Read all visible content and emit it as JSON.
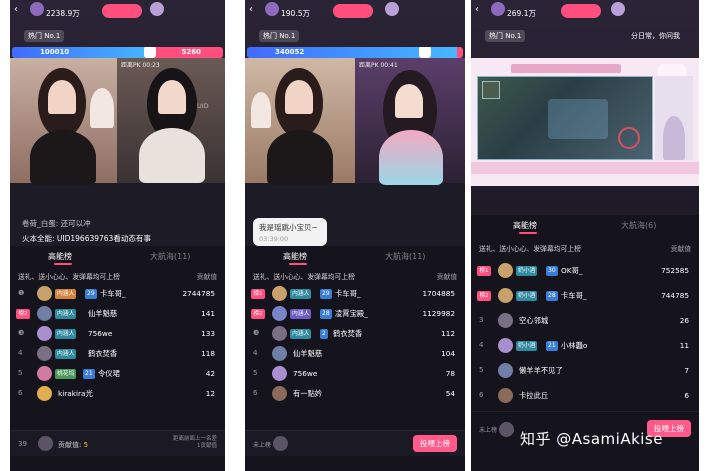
{
  "panels": [
    {
      "fans": "2238.9万",
      "hot": "热门 No.1",
      "pk_left": "100010",
      "pk_right": "5260",
      "timer_left": "距离PK 00:23",
      "uid_text": "UID",
      "chat": [
        {
          "text": "卷荷_白蛋: 还可以冲",
          "dim": true
        },
        {
          "text": "火本全能: UID196639763看动态有事",
          "dim": false
        }
      ],
      "tabs": {
        "active": "高能榜",
        "inactive": "大航海(11)"
      },
      "hint": "送礼、送小心心、发弹幕均可上榜",
      "hint_right": "贡献值",
      "rows": [
        {
          "rank": "",
          "tag": "内涵人",
          "lvl": "29",
          "name": "卡车哥_",
          "score": "2744785",
          "color": "#c9a26b"
        },
        {
          "rank": "榜2",
          "tag": "内涵人",
          "lvl": "",
          "name": "仙羊魁慈",
          "score": "141",
          "color": "#6f7fa6"
        },
        {
          "rank": "",
          "tag": "内涵人",
          "lvl": "",
          "name": "756we",
          "score": "133",
          "color": "#a98fd0"
        },
        {
          "rank": "4",
          "tag": "内涵人",
          "lvl": "",
          "name": "鹤衣焚香",
          "score": "118",
          "color": "#7a6f85"
        },
        {
          "rank": "5",
          "tag": "桃花坞",
          "lvl": "21",
          "name": "令仪珺",
          "score": "42",
          "color": "#d27aa0"
        },
        {
          "rank": "6",
          "tag": "",
          "lvl": "",
          "name": "kirakira光",
          "score": "12",
          "color": "#e0b050"
        }
      ],
      "footer": {
        "rank": "39",
        "gv_label": "贡献值:",
        "gv_value": "5",
        "note": "距离前面上一名差\n1贡献值"
      }
    },
    {
      "fans": "190.5万",
      "hot": "热门 No.1",
      "pk_left": "340052",
      "timer_left": "距离PK 00:41",
      "bubble": {
        "text": "我是瑶跳小宝贝~",
        "time": "03:39:00"
      },
      "tabs": {
        "active": "高能榜",
        "inactive": "大航海(11)"
      },
      "hint": "送礼、送小心心、发弹幕均可上榜",
      "hint_right": "贡献值",
      "rows": [
        {
          "rank": "榜1",
          "tag": "内涵人",
          "lvl": "29",
          "name": "卡车哥_",
          "score": "1704885",
          "color": "#c9a26b"
        },
        {
          "rank": "榜2",
          "tag": "内涵人",
          "lvl": "28",
          "name": "凌霄宝殿_",
          "score": "1129982",
          "color": "#7b84c8"
        },
        {
          "rank": "",
          "tag": "内涵人",
          "lvl": "2",
          "name": "鹤衣焚香",
          "score": "112",
          "color": "#7a6f85"
        },
        {
          "rank": "4",
          "tag": "",
          "lvl": "",
          "name": "仙羊魁慈",
          "score": "104",
          "color": "#6f7fa6"
        },
        {
          "rank": "5",
          "tag": "",
          "lvl": "",
          "name": "756we",
          "score": "78",
          "color": "#a98fd0"
        },
        {
          "rank": "6",
          "tag": "",
          "lvl": "",
          "name": "有一點妗",
          "score": "54",
          "color": "#8a6a5a"
        }
      ],
      "footer": {
        "rank": "未上榜",
        "cta": "投喂上榜"
      }
    },
    {
      "fans": "269.1万",
      "hot": "热门 No.1",
      "top_right": "分日常，你问我",
      "tabs": {
        "active": "高能榜",
        "inactive": "大航海(6)"
      },
      "hint": "送礼、送小心心、发弹幕均可上榜",
      "hint_right": "贡献值",
      "rows": [
        {
          "rank": "榜1",
          "tag": "奶小酒",
          "lvl": "30",
          "name": "OK哥_",
          "score": "752585",
          "color": "#c9a26b"
        },
        {
          "rank": "榜2",
          "tag": "奶小酒",
          "lvl": "28",
          "name": "卡车哥_",
          "score": "744785",
          "color": "#c9a26b"
        },
        {
          "rank": "3",
          "tag": "",
          "lvl": "",
          "name": "空心邻城",
          "score": "26",
          "color": "#7a6f85"
        },
        {
          "rank": "4",
          "tag": "奶小酒",
          "lvl": "21",
          "name": "小林龘o",
          "score": "11",
          "color": "#a98fd0"
        },
        {
          "rank": "5",
          "tag": "",
          "lvl": "",
          "name": "懒羊羊不见了",
          "score": "7",
          "color": "#6f7fa6"
        },
        {
          "rank": "6",
          "tag": "",
          "lvl": "",
          "name": "卡拉此丘",
          "score": "6",
          "color": "#8a6a5a"
        }
      ],
      "footer": {
        "rank": "未上榜",
        "cta": "投喂上榜"
      }
    }
  ],
  "watermark": "知乎 @AsamiAkise",
  "colors": {
    "accent": "#ff4f7e",
    "sheet_bg": "#15141d",
    "gold": "#f6c343",
    "tag_blue": "#3a7dd8"
  }
}
